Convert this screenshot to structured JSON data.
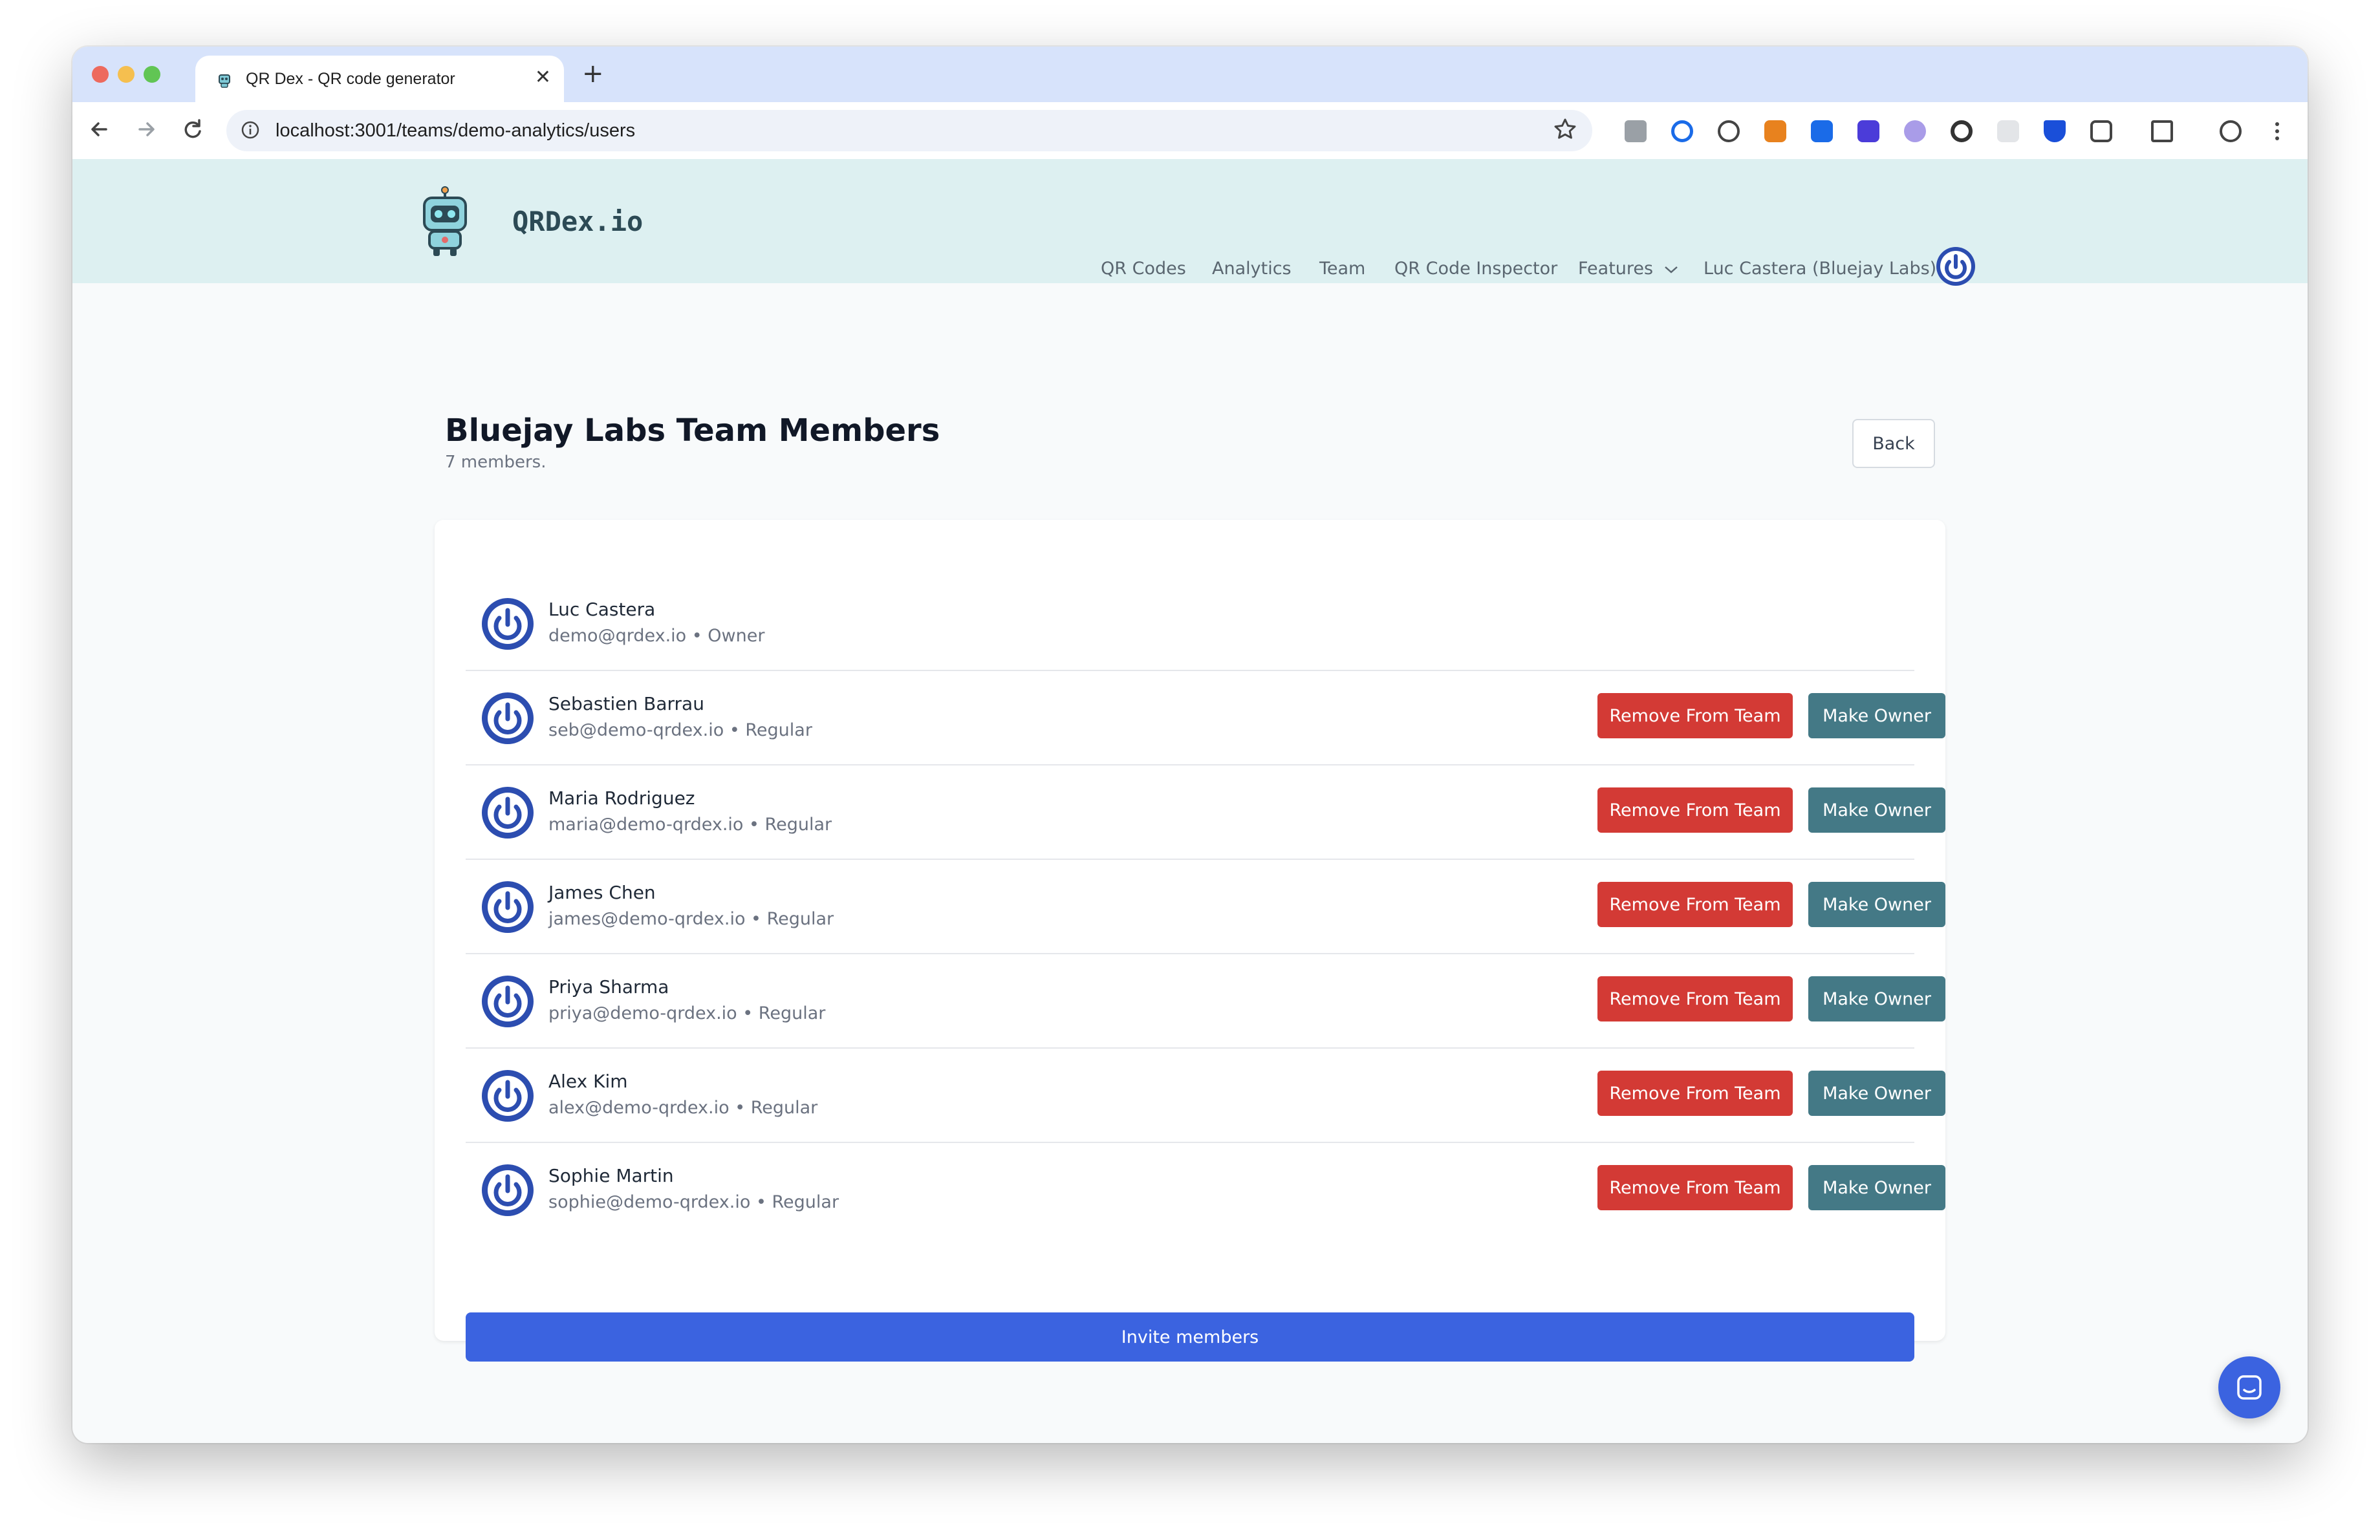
{
  "browser": {
    "tab_title": "QR Dex - QR code generator",
    "tab_close": "✕",
    "new_tab": "+",
    "url": "localhost:3001/teams/demo-analytics/users"
  },
  "header": {
    "logo_text": "QRDex.io",
    "nav": [
      "QR Codes",
      "Analytics",
      "Team",
      "QR Code Inspector",
      "Features"
    ],
    "user": "Luc Castera (Bluejay Labs)"
  },
  "page": {
    "title": "Bluejay Labs Team Members",
    "subtitle": "7 members.",
    "back_label": "Back"
  },
  "members": [
    {
      "name": "Luc Castera",
      "email": "demo@qrdex.io",
      "role": "Owner"
    },
    {
      "name": "Sebastien Barrau",
      "email": "seb@demo-qrdex.io",
      "role": "Regular"
    },
    {
      "name": "Maria Rodriguez",
      "email": "maria@demo-qrdex.io",
      "role": "Regular"
    },
    {
      "name": "James Chen",
      "email": "james@demo-qrdex.io",
      "role": "Regular"
    },
    {
      "name": "Priya Sharma",
      "email": "priya@demo-qrdex.io",
      "role": "Regular"
    },
    {
      "name": "Alex Kim",
      "email": "alex@demo-qrdex.io",
      "role": "Regular"
    },
    {
      "name": "Sophie Martin",
      "email": "sophie@demo-qrdex.io",
      "role": "Regular"
    }
  ],
  "actions": {
    "remove_label": "Remove From Team",
    "make_owner_label": "Make Owner",
    "invite_label": "Invite members"
  },
  "colors": {
    "accent": "#3b63e0",
    "danger": "#d33a35",
    "teal": "#447986",
    "header_bg": "#ddf0f1",
    "avatar_blue": "#2c4db0"
  }
}
